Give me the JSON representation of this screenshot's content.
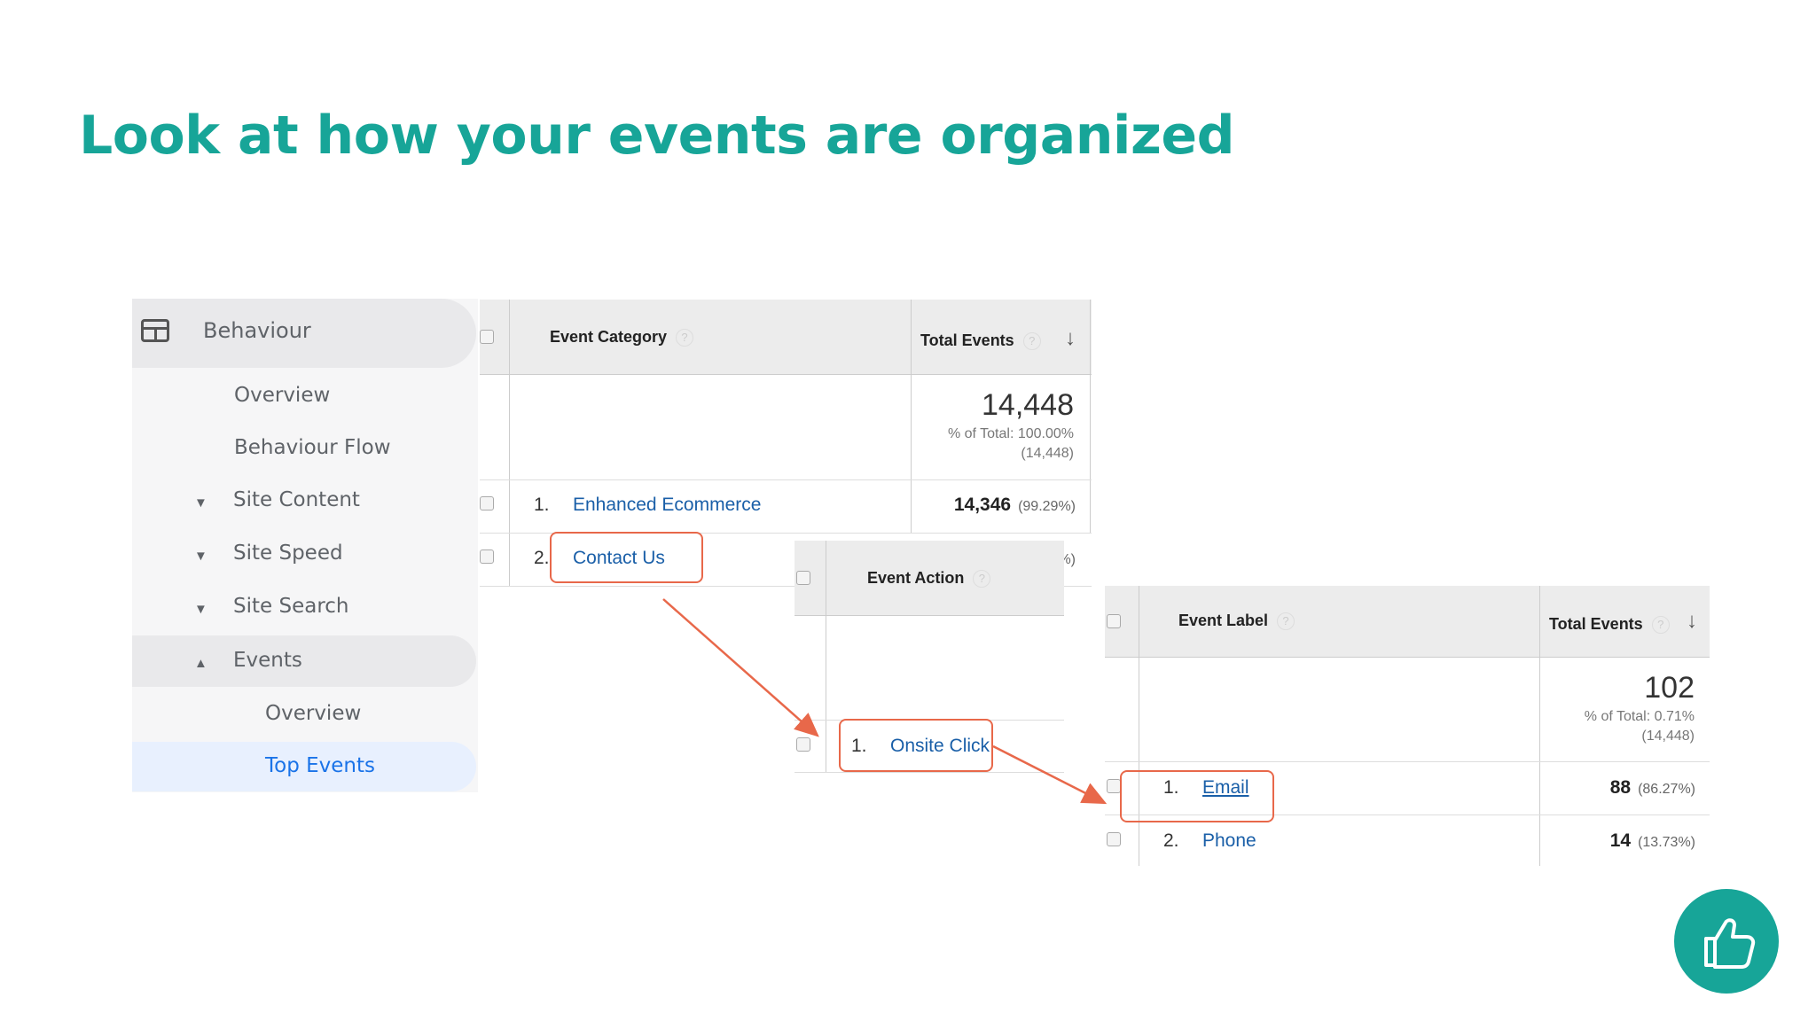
{
  "title": "Look at how your events are organized",
  "sidebar": {
    "header": "Behaviour",
    "items": [
      {
        "label": "Overview",
        "expand": ""
      },
      {
        "label": "Behaviour Flow",
        "expand": ""
      },
      {
        "label": "Site Content",
        "expand": "▼"
      },
      {
        "label": "Site Speed",
        "expand": "▼"
      },
      {
        "label": "Site Search",
        "expand": "▼"
      },
      {
        "label": "Events",
        "expand": "▲"
      },
      {
        "label": "Overview",
        "expand": ""
      },
      {
        "label": "Top Events",
        "expand": ""
      }
    ]
  },
  "category_table": {
    "col1": "Event Category",
    "col2": "Total Events",
    "total": "14,448",
    "total_pct": "% of Total: 100.00%",
    "total_abs": "(14,448)",
    "rows": [
      {
        "num": "1.",
        "label": "Enhanced Ecommerce",
        "value": "14,346",
        "pct": "(99.29%)"
      },
      {
        "num": "2.",
        "label": "Contact Us",
        "value": "",
        "pct": "%)"
      }
    ]
  },
  "action_table": {
    "col1": "Event Action",
    "rows": [
      {
        "num": "1.",
        "label": "Onsite Click"
      }
    ]
  },
  "label_table": {
    "col1": "Event Label",
    "col2": "Total Events",
    "total": "102",
    "total_pct": "% of Total: 0.71%",
    "total_abs": "(14,448)",
    "rows": [
      {
        "num": "1.",
        "label": "Email",
        "value": "88",
        "pct": "(86.27%)"
      },
      {
        "num": "2.",
        "label": "Phone",
        "value": "14",
        "pct": "(13.73%)"
      }
    ]
  },
  "icons": {
    "help": "?",
    "sort": "↓"
  },
  "colors": {
    "accent": "#17a598",
    "link": "#1a5fa8",
    "highlight": "#e8684a"
  }
}
